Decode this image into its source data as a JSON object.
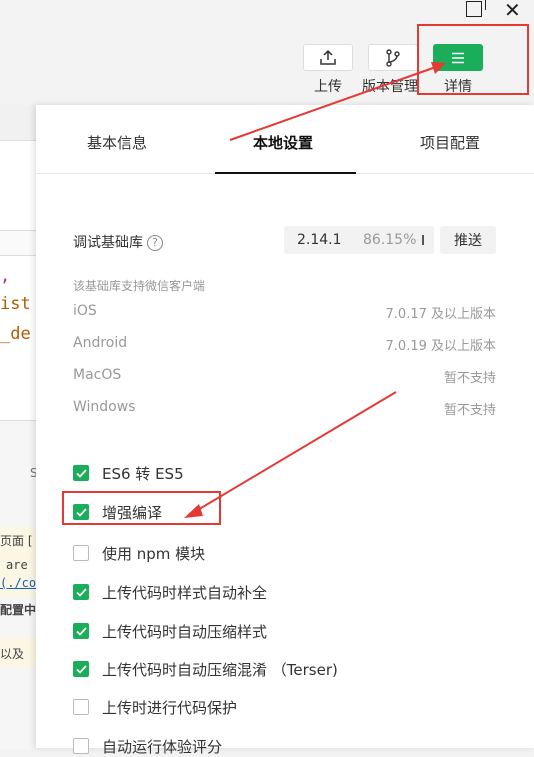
{
  "toolbar": {
    "upload_label": "上传",
    "version_label": "版本管理",
    "detail_label": "详情"
  },
  "editor_fragments": [
    ",",
    "ist",
    "_de"
  ],
  "console_fragments": [
    "S",
    "页面 [",
    "are",
    "(./co",
    "配置中",
    "以及"
  ],
  "panel": {
    "tabs": [
      {
        "label": "基本信息",
        "active": false
      },
      {
        "label": "本地设置",
        "active": true
      },
      {
        "label": "项目配置",
        "active": false
      }
    ],
    "debug_lib": {
      "label": "调试基础库",
      "help_icon": "question-circle-icon",
      "version": "2.14.1",
      "coverage": "86.15%",
      "push_label": "推送"
    },
    "support": {
      "heading": "该基础库支持微信客户端",
      "rows": [
        {
          "platform": "iOS",
          "value": "7.0.17 及以上版本"
        },
        {
          "platform": "Android",
          "value": "7.0.19 及以上版本"
        },
        {
          "platform": "MacOS",
          "value": "暂不支持"
        },
        {
          "platform": "Windows",
          "value": "暂不支持"
        }
      ]
    },
    "options": [
      {
        "label": "ES6 转 ES5",
        "checked": true
      },
      {
        "label": "增强编译",
        "checked": true
      },
      {
        "label": "使用 npm 模块",
        "checked": false
      },
      {
        "label": "上传代码时样式自动补全",
        "checked": true
      },
      {
        "label": "上传代码时自动压缩样式",
        "checked": true
      },
      {
        "label": "上传代码时自动压缩混淆 （Terser)",
        "checked": true
      },
      {
        "label": "上传时进行代码保护",
        "checked": false
      },
      {
        "label": "自动运行体验评分",
        "checked": false
      }
    ]
  },
  "colors": {
    "accent_green": "#1aad5a",
    "annotation_red": "#e53935"
  }
}
